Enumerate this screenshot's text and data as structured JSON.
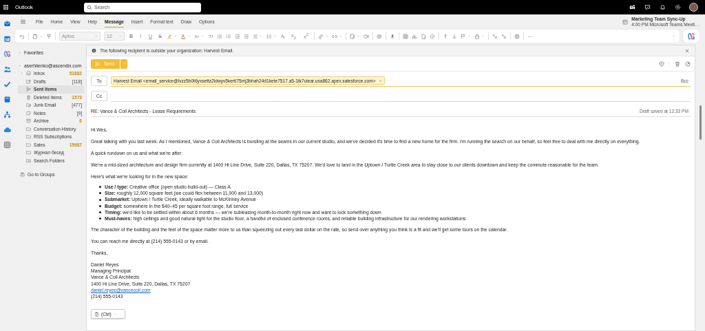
{
  "top_bar": {
    "app_name": "Outlook",
    "search": {
      "placeholder": "Search"
    }
  },
  "ribbon": {
    "tabs": [
      {
        "label": "File",
        "selected": false
      },
      {
        "label": "Home",
        "selected": false
      },
      {
        "label": "View",
        "selected": false
      },
      {
        "label": "Help",
        "selected": false
      },
      {
        "label": "Message",
        "selected": true
      },
      {
        "label": "Insert",
        "selected": false
      },
      {
        "label": "Format text",
        "selected": false
      },
      {
        "label": "Draw",
        "selected": false
      },
      {
        "label": "Options",
        "selected": false
      }
    ],
    "font": "Aptos",
    "font_size": "12",
    "format_buttons": [
      {
        "label": "B",
        "kind": "bold"
      },
      {
        "label": "I",
        "kind": "italic"
      },
      {
        "label": "U",
        "kind": "underline"
      },
      {
        "label": "S",
        "kind": "strike"
      }
    ],
    "script_buttons": [
      {
        "label": "x",
        "mark": "2",
        "kind": "sub"
      },
      {
        "label": "x",
        "mark": "2",
        "kind": "sup"
      }
    ]
  },
  "reminder": {
    "title": "Marketing Team Sync-Up",
    "detail": "4:00 PM Microsoft Teams Meeti…"
  },
  "folders": {
    "favorites": {
      "label": "Favorites",
      "expanded": false
    },
    "account": {
      "label": "aserhiienko@ascendix.com",
      "expanded": true
    },
    "items": [
      {
        "name": "Inbox",
        "count": "51682",
        "kind": "unread",
        "expandable": true,
        "selected": false
      },
      {
        "name": "Drafts",
        "count": "[118]",
        "kind": "total",
        "expandable": false,
        "selected": false
      },
      {
        "name": "Sent Items",
        "expandable": false,
        "selected": true
      },
      {
        "name": "Deleted Items",
        "count": "1573",
        "kind": "unread",
        "expandable": false,
        "selected": false
      },
      {
        "name": "Junk Email",
        "count": "[477]",
        "kind": "total",
        "expandable": false,
        "selected": false
      },
      {
        "name": "Notes",
        "count": "[9]",
        "kind": "total",
        "expandable": false,
        "selected": false
      },
      {
        "name": "Archive",
        "count": "6",
        "kind": "unread",
        "expandable": false,
        "selected": false
      },
      {
        "name": "Conversation History",
        "expandable": false,
        "selected": false
      },
      {
        "name": "RSS Subscriptions",
        "expandable": false,
        "selected": false
      },
      {
        "name": "Sales",
        "count": "15987",
        "kind": "unread",
        "expandable": false,
        "selected": false
      },
      {
        "name": "Журнал бесед",
        "expandable": false,
        "selected": false
      },
      {
        "name": "Search Folders",
        "expandable": false,
        "selected": false
      }
    ],
    "groups_link": "Go to Groups"
  },
  "compose": {
    "notice": "The following recipient is outside your organization: Harvest Email.",
    "send_label": "Send",
    "to_label": "To",
    "recipient": "Harvest Email <email_service@lvzz5b0t6yxsettz2ldwyv5kerti75mj3bhah24d1kete7517.a5-1tk7uiear.usa862.apex.salesforce.com>",
    "bcc_label": "Bcc",
    "cc_label": "Cc",
    "subject": "RE: Vance & Coil Architects - Lease Requirements",
    "draft_status": "Draft saved at 12:33 PM",
    "body": [
      {
        "kind": "para",
        "text": "Hi Wes,"
      },
      {
        "kind": "para",
        "text": "Great talking with you last week. As I mentioned, Vance & Coil Architects is bursting at the seams in our current studio, and we've decided it's time to find a new home for the firm. I'm running the search on our behalf, so feel free to deal with me directly on everything."
      },
      {
        "kind": "para",
        "text": "A quick rundown on us and what we're after:"
      },
      {
        "kind": "para",
        "text": "We're a mid-sized architecture and design firm currently at 1400 Hi Line Drive, Suite 220, Dallas, TX 75207. We'd love to land in the Uptown / Turtle Creek area to stay close to our clients downtown and keep the commute reasonable for the team."
      },
      {
        "kind": "para",
        "text": "Here's what we're looking for in the new space:"
      },
      {
        "kind": "list",
        "items": [
          "**Use / type:** Creative office (open studio build-out) — Class A",
          "**Size:** roughly 12,000 square feet (we could flex between 11,000 and 13,000)",
          "**Submarket:** Uptown / Turtle Creek, ideally walkable to McKinney Avenue",
          "**Budget:** somewhere in the $40–45 per square foot range, full service",
          "**Timing:** we'd like to be settled within about 6 months — we're subleasing month-to-month right now and want to lock something down",
          "**Must-haves:** high ceilings and good natural light for the studio floor, a handful of enclosed conference rooms, and reliable building infrastructure for our rendering workstations"
        ]
      },
      {
        "kind": "para",
        "text": "The character of the building and the feel of the space matter more to us than squeezing out every last dollar on the rate, so send over anything you think is a fit and we'll get some tours on the calendar."
      },
      {
        "kind": "para",
        "text": "You can reach me directly at (214) 555-0143 or by email."
      },
      {
        "kind": "para",
        "text": "Thanks,"
      },
      {
        "kind": "signature",
        "lines": [
          {
            "kind": "text",
            "text": "Daniel Reyes"
          },
          {
            "kind": "text",
            "text": "Managing Principal"
          },
          {
            "kind": "text",
            "text": "Vance & Coil Architects"
          },
          {
            "kind": "text",
            "text": "1400 Hi Line Drive, Suite 220, Dallas, TX 75207"
          },
          {
            "kind": "link",
            "text": "daniel.reyes@vancecoil.com"
          },
          {
            "kind": "text",
            "text": "(214) 555-0143"
          }
        ]
      }
    ],
    "paste_options": "(Ctrl)"
  }
}
